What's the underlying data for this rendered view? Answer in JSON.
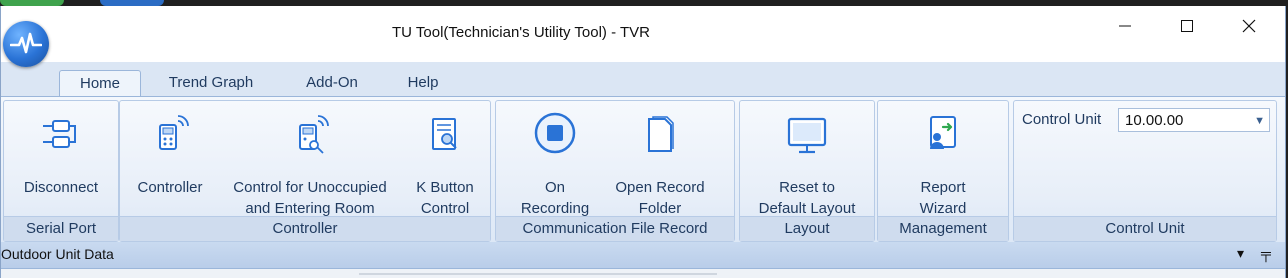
{
  "window": {
    "title": "TU Tool(Technician's Utility Tool) - TVR"
  },
  "tabs": [
    {
      "label": "Home",
      "active": true
    },
    {
      "label": "Trend Graph",
      "active": false
    },
    {
      "label": "Add-On",
      "active": false
    },
    {
      "label": "Help",
      "active": false
    }
  ],
  "ribbon": {
    "serial_port": {
      "group_label": "Serial Port",
      "disconnect": {
        "line1": "Disconnect",
        "line2": ""
      }
    },
    "controller": {
      "group_label": "Controller",
      "controller_btn": {
        "line1": "Controller",
        "line2": ""
      },
      "unoccupied_btn": {
        "line1": "Control for Unoccupied",
        "line2": "and Entering Room"
      },
      "kbutton_btn": {
        "line1": "K Button",
        "line2": "Control"
      }
    },
    "communication": {
      "group_label": "Communication File Record",
      "on_recording": {
        "line1": "On",
        "line2": "Recording"
      },
      "open_folder": {
        "line1": "Open Record",
        "line2": "Folder"
      }
    },
    "layout": {
      "group_label": "Layout",
      "reset": {
        "line1": "Reset to",
        "line2": "Default Layout"
      }
    },
    "management": {
      "group_label": "Management",
      "report": {
        "line1": "Report",
        "line2": "Wizard"
      }
    },
    "control_unit": {
      "group_label": "Control Unit",
      "label": "Control Unit",
      "value": "10.00.00"
    }
  },
  "pane": {
    "title": "Outdoor Unit Data"
  },
  "colors": {
    "accent": "#2a73d6",
    "ribbon_bg": "#dde8f6",
    "group_label_bg": "#cfdcee",
    "text": "#1f3a5f"
  }
}
